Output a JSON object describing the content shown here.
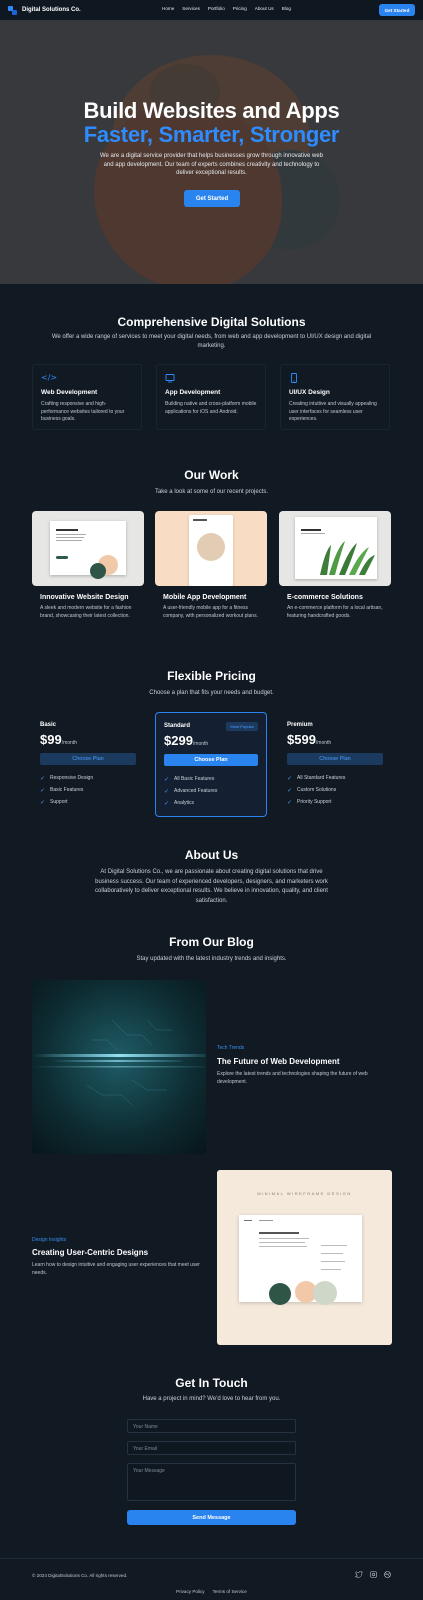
{
  "nav": {
    "brand": "Digital Solutions Co.",
    "links": [
      "Home",
      "Services",
      "Portfolio",
      "Pricing",
      "About Us",
      "Blog"
    ],
    "cta": "Get Started"
  },
  "hero": {
    "title_line1": "Build Websites and Apps",
    "title_line2": "Faster, Smarter, Stronger",
    "description": "We are a digital service provider that helps businesses grow through innovative web and app development. Our team of experts combines creativity and technology to deliver exceptional results.",
    "cta": "Get Started"
  },
  "services": {
    "title": "Comprehensive Digital Solutions",
    "subtitle": "We offer a wide range of services to meet your digital needs, from web and app development to UI/UX design and digital marketing.",
    "items": [
      {
        "icon": "code-icon",
        "name": "Web Development",
        "desc": "Crafting responsive and high-performance websites tailored to your business goals."
      },
      {
        "icon": "monitor-icon",
        "name": "App Development",
        "desc": "Building native and cross-platform mobile applications for iOS and Android."
      },
      {
        "icon": "mobile-icon",
        "name": "UI/UX Design",
        "desc": "Creating intuitive and visually appealing user interfaces for seamless user experiences."
      }
    ]
  },
  "work": {
    "title": "Our Work",
    "subtitle": "Take a look at some of our recent projects.",
    "items": [
      {
        "name": "Innovative Website Design",
        "desc": "A sleek and modern website for a fashion brand, showcasing their latest collection."
      },
      {
        "name": "Mobile App Development",
        "desc": "A user-friendly mobile app for a fitness company, with personalized workout plans."
      },
      {
        "name": "E-commerce Solutions",
        "desc": "An e-commerce platform for a local artisan, featuring handcrafted goods."
      }
    ]
  },
  "pricing": {
    "title": "Flexible Pricing",
    "subtitle": "Choose a plan that fits your needs and budget.",
    "per": "/month",
    "button": "Choose Plan",
    "badge": "Most Popular",
    "plans": [
      {
        "name": "Basic",
        "price": "$99",
        "features": [
          "Responsive Design",
          "Basic Features",
          "Support"
        ]
      },
      {
        "name": "Standard",
        "price": "$299",
        "features": [
          "All Basic Features",
          "Advanced Features",
          "Analytics"
        ]
      },
      {
        "name": "Premium",
        "price": "$599",
        "features": [
          "All Standard Features",
          "Custom Solutions",
          "Priority Support"
        ]
      }
    ]
  },
  "about": {
    "title": "About Us",
    "text": "At Digital Solutions Co., we are passionate about creating digital solutions that drive business success. Our team of experienced developers, designers, and marketers work collaboratively to deliver exceptional results. We believe in innovation, quality, and client satisfaction."
  },
  "blog": {
    "title": "From Our Blog",
    "subtitle": "Stay updated with the latest industry trends and insights.",
    "posts": [
      {
        "category": "Tech Trends",
        "title": "The Future of Web Development",
        "desc": "Explore the latest trends and technologies shaping the future of web development."
      },
      {
        "category": "Design Insights",
        "title": "Creating User-Centric Designs",
        "desc": "Learn how to design intuitive and engaging user experiences that meet user needs."
      }
    ],
    "image2_caption": "MINIMAL WIREFRAME DESIGN"
  },
  "contact": {
    "title": "Get In Touch",
    "subtitle": "Have a project in mind? We'd love to hear from you.",
    "name_placeholder": "Your Name",
    "email_placeholder": "Your Email",
    "message_placeholder": "Your Message",
    "button": "Send Message"
  },
  "footer": {
    "copyright": "© 2024 DigitalSolutions Co. All rights reserved.",
    "links": [
      "Privacy Policy",
      "Terms of Service"
    ],
    "social": [
      "twitter-icon",
      "instagram-icon",
      "dribbble-icon"
    ]
  },
  "colors": {
    "accent": "#2a84f0",
    "background": "#111923"
  }
}
